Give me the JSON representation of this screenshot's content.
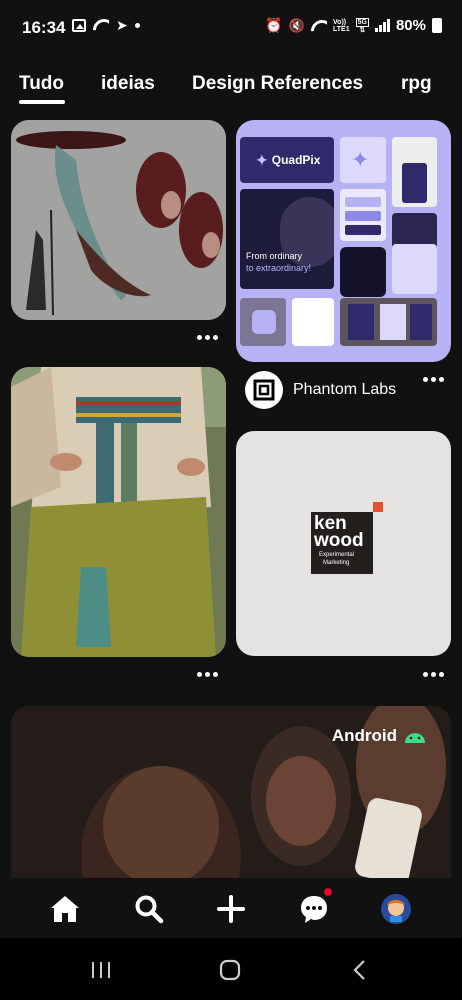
{
  "status_bar": {
    "time": "16:34",
    "volte": "Vo))",
    "lte": "LTE1",
    "network": "5G",
    "battery": "80%"
  },
  "tabs": [
    "Tudo",
    "ideias",
    "Design References",
    "rpg"
  ],
  "active_tab": "Tudo",
  "pins": {
    "quadpix": {
      "brand": "QuadPix",
      "tagline_1": "From ordinary",
      "tagline_2": "to extraordinary!"
    },
    "creator": {
      "name": "Phantom Labs"
    },
    "kenwood": {
      "line1": "ken",
      "line2": "wood",
      "line3": "Experimental",
      "line4": "Marketing"
    },
    "android_ad": {
      "brand": "Android"
    }
  },
  "bottom_nav": [
    "home-icon",
    "search-icon",
    "create-icon",
    "messages-icon",
    "profile-avatar"
  ],
  "colors": {
    "background": "#111111",
    "quadpix_purple": "#b6b2f3",
    "notification_dot": "#e60023"
  }
}
